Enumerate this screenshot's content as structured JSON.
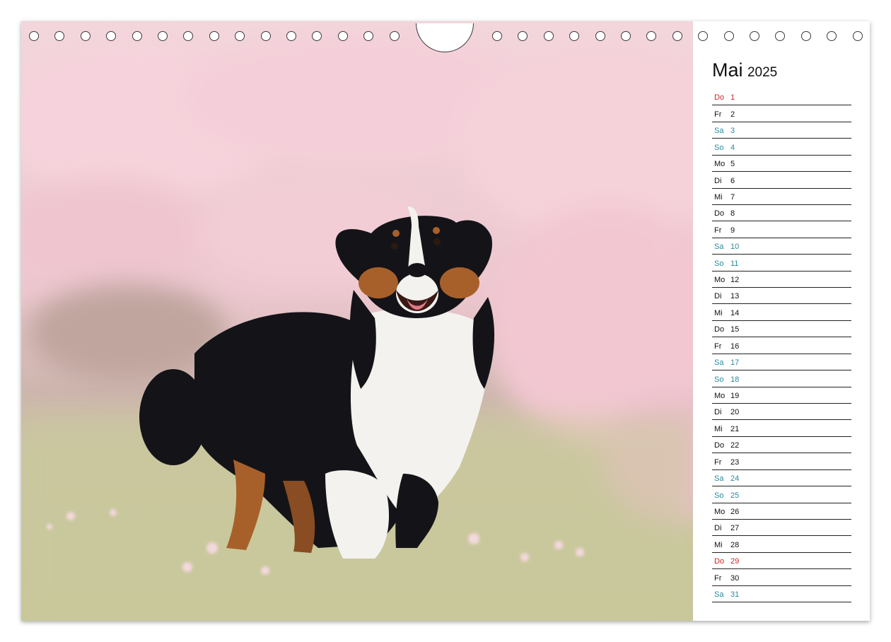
{
  "calendar": {
    "month": "Mai",
    "year": "2025",
    "days": [
      {
        "wd": "Do",
        "num": "1",
        "type": "holiday"
      },
      {
        "wd": "Fr",
        "num": "2",
        "type": "weekday"
      },
      {
        "wd": "Sa",
        "num": "3",
        "type": "weekend"
      },
      {
        "wd": "So",
        "num": "4",
        "type": "weekend"
      },
      {
        "wd": "Mo",
        "num": "5",
        "type": "weekday"
      },
      {
        "wd": "Di",
        "num": "6",
        "type": "weekday"
      },
      {
        "wd": "Mi",
        "num": "7",
        "type": "weekday"
      },
      {
        "wd": "Do",
        "num": "8",
        "type": "weekday"
      },
      {
        "wd": "Fr",
        "num": "9",
        "type": "weekday"
      },
      {
        "wd": "Sa",
        "num": "10",
        "type": "weekend"
      },
      {
        "wd": "So",
        "num": "11",
        "type": "weekend"
      },
      {
        "wd": "Mo",
        "num": "12",
        "type": "weekday"
      },
      {
        "wd": "Di",
        "num": "13",
        "type": "weekday"
      },
      {
        "wd": "Mi",
        "num": "14",
        "type": "weekday"
      },
      {
        "wd": "Do",
        "num": "15",
        "type": "weekday"
      },
      {
        "wd": "Fr",
        "num": "16",
        "type": "weekday"
      },
      {
        "wd": "Sa",
        "num": "17",
        "type": "weekend"
      },
      {
        "wd": "So",
        "num": "18",
        "type": "weekend"
      },
      {
        "wd": "Mo",
        "num": "19",
        "type": "weekday"
      },
      {
        "wd": "Di",
        "num": "20",
        "type": "weekday"
      },
      {
        "wd": "Mi",
        "num": "21",
        "type": "weekday"
      },
      {
        "wd": "Do",
        "num": "22",
        "type": "weekday"
      },
      {
        "wd": "Fr",
        "num": "23",
        "type": "weekday"
      },
      {
        "wd": "Sa",
        "num": "24",
        "type": "weekend"
      },
      {
        "wd": "So",
        "num": "25",
        "type": "weekend"
      },
      {
        "wd": "Mo",
        "num": "26",
        "type": "weekday"
      },
      {
        "wd": "Di",
        "num": "27",
        "type": "weekday"
      },
      {
        "wd": "Mi",
        "num": "28",
        "type": "weekday"
      },
      {
        "wd": "Do",
        "num": "29",
        "type": "holiday"
      },
      {
        "wd": "Fr",
        "num": "30",
        "type": "weekday"
      },
      {
        "wd": "Sa",
        "num": "31",
        "type": "weekend"
      }
    ]
  },
  "photo": {
    "subject": "dog-photo",
    "colors": {
      "blossom": "#f2c9d2",
      "grass": "#c8c99a",
      "fur_black": "#141418",
      "fur_white": "#f4f2ee",
      "fur_tan": "#a8602a"
    }
  },
  "colors": {
    "weekend": "#2a8a9a",
    "holiday": "#d02525",
    "text": "#111111"
  }
}
